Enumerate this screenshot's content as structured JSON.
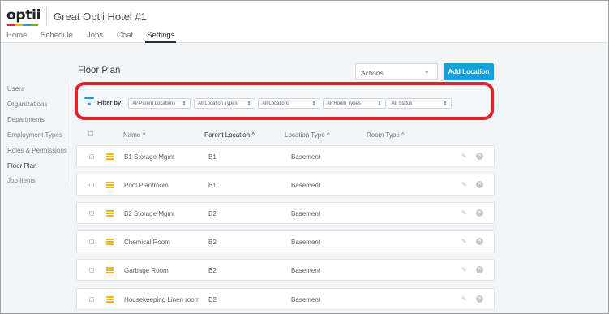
{
  "app": {
    "logo_text": "optii",
    "logo_colors": [
      "#e8202a",
      "#f5b800",
      "#1aa0d8",
      "#7ab800"
    ],
    "hotel_name": "Great Optii Hotel #1"
  },
  "nav": {
    "tabs": [
      {
        "label": "Home"
      },
      {
        "label": "Schedule"
      },
      {
        "label": "Jobs"
      },
      {
        "label": "Chat"
      },
      {
        "label": "Settings",
        "active": true
      }
    ]
  },
  "sidebar": {
    "items": [
      {
        "label": "Users"
      },
      {
        "label": "Organizations"
      },
      {
        "label": "Departments"
      },
      {
        "label": "Employment Types"
      },
      {
        "label": "Roles & Permissions"
      },
      {
        "label": "Floor Plan",
        "active": true
      },
      {
        "label": "Job Items"
      }
    ]
  },
  "main": {
    "title": "Floor Plan",
    "actions_select": {
      "value": "Actions",
      "icon": "chevron-down-icon"
    },
    "add_button": "Add Location",
    "highlight_color": "#e8202a",
    "filter": {
      "label": "Filter by",
      "selects": [
        {
          "value": "All Parent Locations"
        },
        {
          "value": "All Location Types"
        },
        {
          "value": "All Locations"
        },
        {
          "value": "All Room Types"
        },
        {
          "value": "All Status"
        }
      ]
    },
    "columns": {
      "name": "Name ^",
      "parent": "Parent Location ^",
      "type": "Location Type ^",
      "room": "Room Type ^"
    },
    "rows": [
      {
        "name": "B1 Storage Mgmt",
        "parent": "B1",
        "type": "Basement"
      },
      {
        "name": "Pool Plantroom",
        "parent": "B1",
        "type": "Basement"
      },
      {
        "name": "B2 Storage Mgmt",
        "parent": "B2",
        "type": "Basement"
      },
      {
        "name": "Chemical Room",
        "parent": "B2",
        "type": "Basement"
      },
      {
        "name": "Garbage Room",
        "parent": "B2",
        "type": "Basement"
      },
      {
        "name": "Housekeeping Linen room",
        "parent": "B2",
        "type": "Basement"
      }
    ]
  }
}
